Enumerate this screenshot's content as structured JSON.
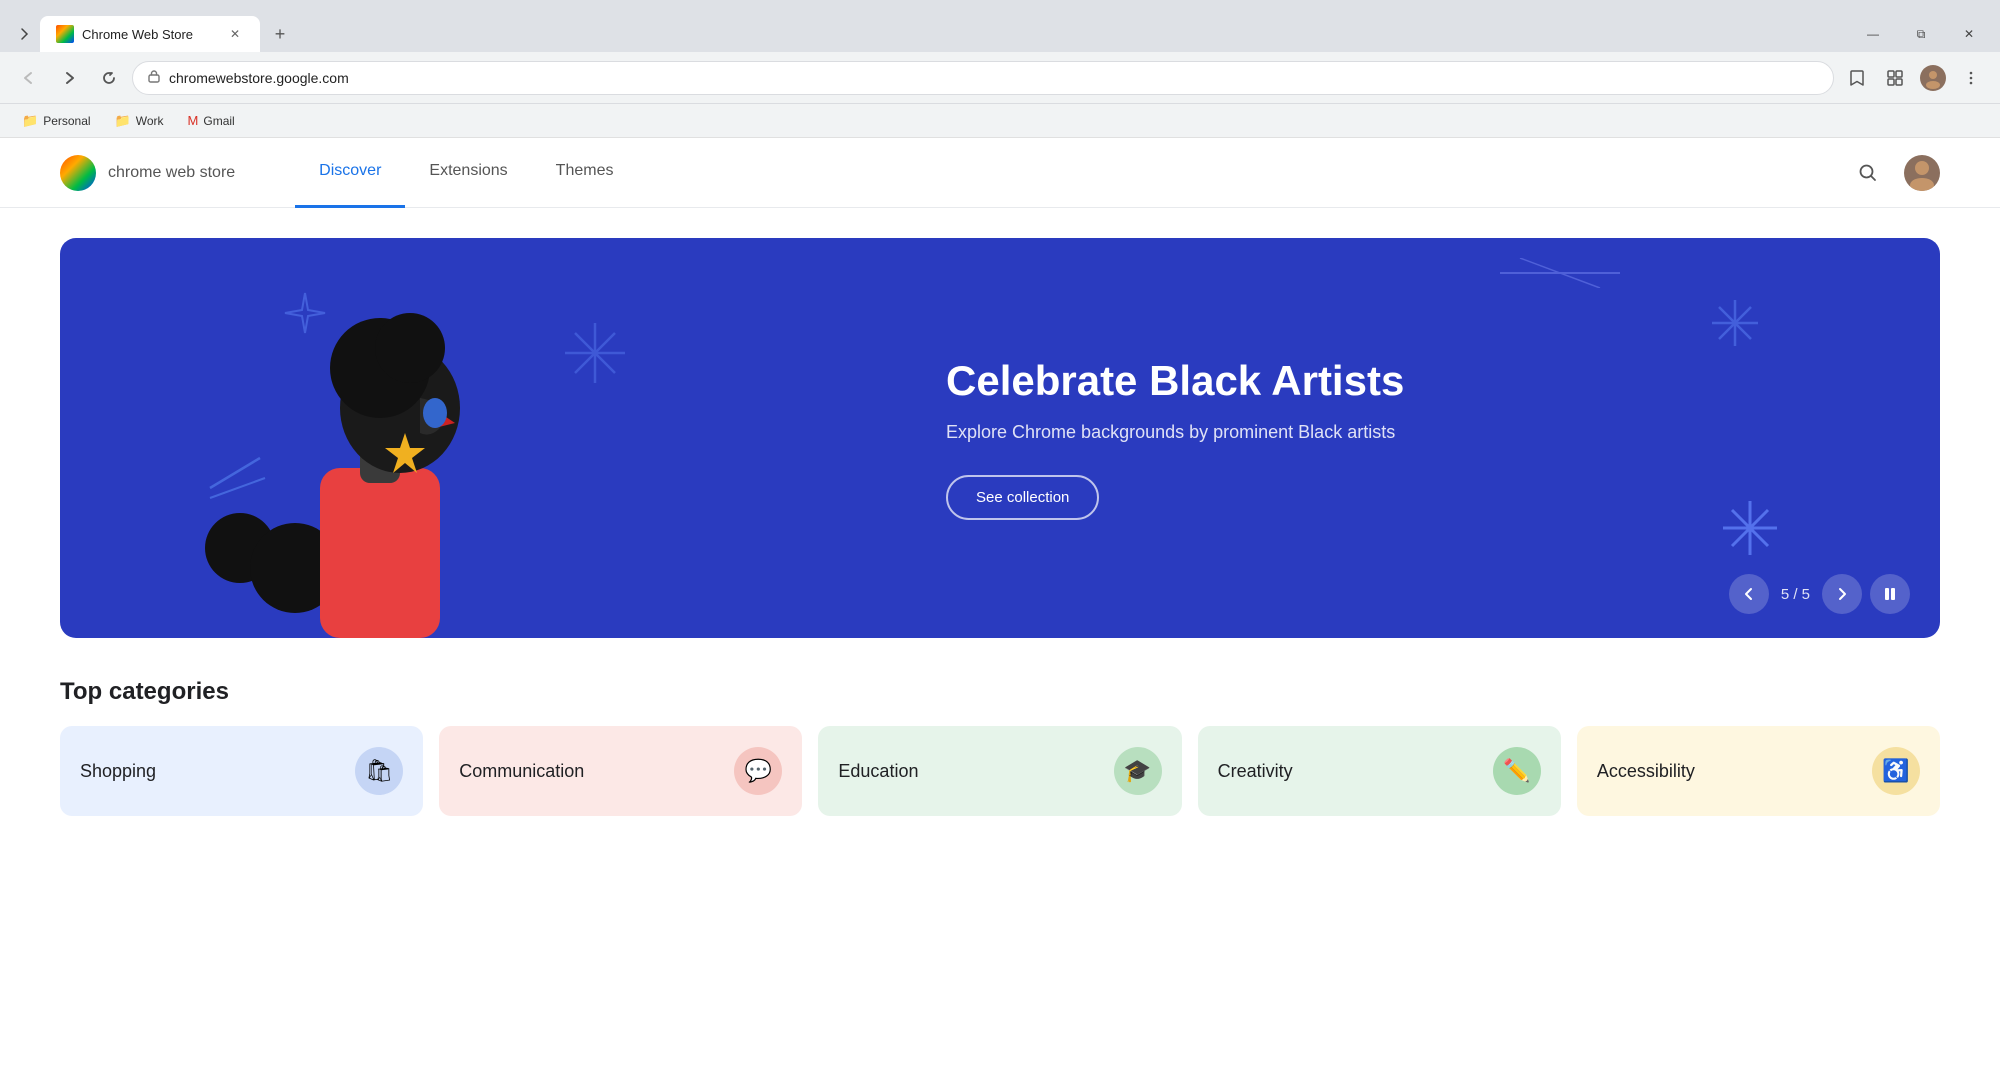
{
  "browser": {
    "tab": {
      "title": "Chrome Web Store",
      "favicon_alt": "chrome-web-store-favicon"
    },
    "address": "chromewebstore.google.com",
    "window_controls": {
      "minimize": "—",
      "maximize": "❐",
      "close": "✕"
    }
  },
  "bookmarks": [
    {
      "id": "personal",
      "label": "Personal",
      "icon": "📁"
    },
    {
      "id": "work",
      "label": "Work",
      "icon": "📁"
    },
    {
      "id": "gmail",
      "label": "Gmail",
      "icon": "✉"
    }
  ],
  "cws": {
    "logo_text": "chrome web store",
    "nav": [
      {
        "id": "discover",
        "label": "Discover",
        "active": true
      },
      {
        "id": "extensions",
        "label": "Extensions",
        "active": false
      },
      {
        "id": "themes",
        "label": "Themes",
        "active": false
      }
    ]
  },
  "hero": {
    "title": "Celebrate Black Artists",
    "subtitle": "Explore Chrome backgrounds by prominent Black artists",
    "cta_label": "See collection",
    "slide_current": "5",
    "slide_total": "5",
    "slide_counter": "5 / 5"
  },
  "categories": {
    "section_title": "Top categories",
    "items": [
      {
        "id": "shopping",
        "label": "Shopping",
        "icon": "🛍",
        "color_class": "cat-shopping",
        "icon_bg": "#c5d5f5"
      },
      {
        "id": "communication",
        "label": "Communication",
        "icon": "💬",
        "color_class": "cat-communication",
        "icon_bg": "#f5c5c0"
      },
      {
        "id": "education",
        "label": "Education",
        "icon": "🎓",
        "color_class": "cat-education",
        "icon_bg": "#b8dfbf"
      },
      {
        "id": "creativity",
        "label": "Creativity",
        "icon": "✏️",
        "color_class": "cat-creativity",
        "icon_bg": "#a8d9b0"
      },
      {
        "id": "accessibility",
        "label": "Accessibility",
        "icon": "♿",
        "color_class": "cat-accessibility",
        "icon_bg": "#f5e0a0"
      }
    ]
  }
}
